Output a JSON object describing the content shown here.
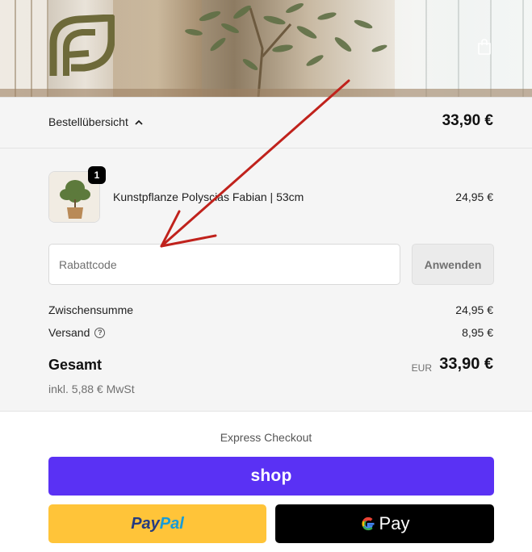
{
  "header": {
    "logo_icon": "fabian-leaf-logo-icon",
    "cart_icon": "shopping-bag-icon"
  },
  "summary_bar": {
    "toggle_label": "Bestellübersicht",
    "toggle_icon": "chevron-up-icon",
    "total": "33,90 €"
  },
  "cart": {
    "items": [
      {
        "name": "Kunstpflanze Polyscias Fabian | 53cm",
        "quantity": "1",
        "price": "24,95 €"
      }
    ]
  },
  "discount": {
    "placeholder": "Rabattcode",
    "value": "",
    "apply_label": "Anwenden"
  },
  "totals": {
    "subtotal_label": "Zwischensumme",
    "subtotal_value": "24,95 €",
    "shipping_label": "Versand",
    "shipping_value": "8,95 €",
    "total_label": "Gesamt",
    "currency": "EUR",
    "total_value": "33,90 €",
    "tax_note": "inkl. 5,88 € MwSt"
  },
  "express": {
    "title": "Express Checkout",
    "shop_label": "shop",
    "paypal_pay": "Pay",
    "paypal_pal": "Pal",
    "gpay_label": "Pay"
  },
  "colors": {
    "shop_pay": "#5a31f4",
    "paypal": "#ffc439",
    "gpay": "#000000",
    "annotation": "#c0221c",
    "logo": "#6e6a3a"
  }
}
